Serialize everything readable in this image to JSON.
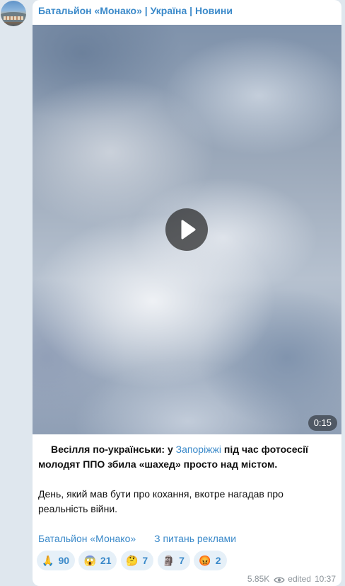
{
  "channel": {
    "name": "Батальйон «Монако» | Україна | Новини"
  },
  "video": {
    "duration": "0:15"
  },
  "post": {
    "lead_start": "Весілля по-українськи: у ",
    "lead_link": "Запоріжжі",
    "lead_end": " під час фотосесії молодят ППО збила «шахед» просто над містом.",
    "second_paragraph": "День, який мав бути про кохання, вкотре нагадав про реальність війни."
  },
  "footer_links": {
    "channel_link": "Батальйон «Монако»",
    "ads_link": "З питань реклами"
  },
  "reactions": [
    {
      "emoji": "🙏",
      "count": "90"
    },
    {
      "emoji": "😱",
      "count": "21"
    },
    {
      "emoji": "🤔",
      "count": "7"
    },
    {
      "emoji": "🗿",
      "count": "7"
    },
    {
      "emoji": "😡",
      "count": "2"
    }
  ],
  "meta": {
    "views": "5.85K",
    "edited_label": "edited",
    "time": "10:37"
  },
  "colors": {
    "accent": "#3a89c9",
    "background": "#dfe7ee",
    "bubble": "#ffffff",
    "reaction_bg": "#e6f0f8",
    "meta_text": "#8d949a"
  },
  "icons": {
    "play": "play-icon",
    "views": "eye-icon"
  }
}
